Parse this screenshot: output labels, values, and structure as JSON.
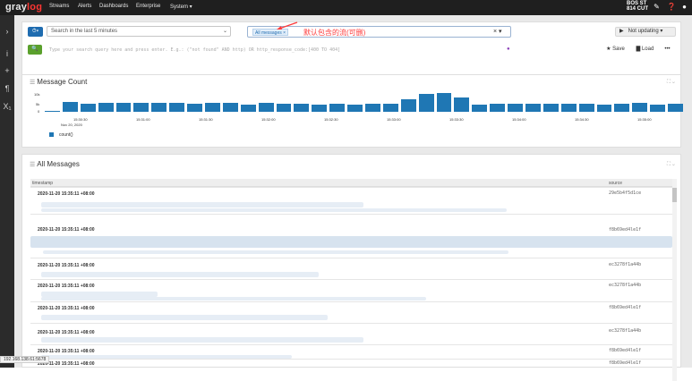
{
  "navbar": {
    "logo_gray": "gray",
    "logo_log": "log",
    "items": [
      "Streams",
      "Alerts",
      "Dashboards",
      "Enterprise",
      "System ▾"
    ],
    "time_top": "BOS ST",
    "time_bottom": "814 CUT",
    "icons": [
      "edit-icon",
      "help-icon",
      "user-icon"
    ]
  },
  "sidebar": {
    "icons": [
      "chevron-right-icon",
      "info-icon",
      "plus-icon",
      "paragraph-icon",
      "x-subscript-icon"
    ]
  },
  "search": {
    "time_range": "Search in the last 5 minutes",
    "stream_tag": "All messages",
    "annotation": "默认包含的流(可删)",
    "query_placeholder": "Type your search query here and press enter. E.g.: (\"not found\" AND http) OR http_response_code:[400 TO 404]",
    "not_updating": "Not updating",
    "save": "Save",
    "load": "Load",
    "more": "•••"
  },
  "message_count": {
    "title": "Message Count",
    "legend": "count()"
  },
  "chart_data": {
    "type": "bar",
    "title": "Message Count",
    "ylim": [
      0,
      10000
    ],
    "yticks": [
      "10k",
      "5k",
      "0"
    ],
    "xticks": [
      "15:30:30",
      "15:31:00",
      "15:31:30",
      "15:32:00",
      "15:32:30",
      "15:33:00",
      "15:33:30",
      "15:34:00",
      "15:34:30",
      "15:35:00"
    ],
    "xdate": "Nov 20, 2020",
    "values": [
      500,
      5300,
      4400,
      4600,
      4700,
      4700,
      5000,
      4800,
      4500,
      4600,
      4900,
      4000,
      4800,
      4300,
      4300,
      4000,
      4500,
      3600,
      4100,
      4300,
      6700,
      9300,
      10000,
      7800,
      3700,
      4500,
      4100,
      4500,
      4200,
      4200,
      4500,
      4000,
      4200,
      4600,
      3700,
      4400
    ],
    "series": [
      {
        "name": "count()",
        "values": []
      }
    ],
    "grid": false,
    "legend": "bottom-left"
  },
  "all_messages": {
    "title": "All Messages",
    "columns": [
      "timestamp",
      "source"
    ],
    "rows": [
      {
        "ts": "2020-11-20 15:35:11 +08:00",
        "source": "29e5b4f5d1ce"
      },
      {
        "ts": "2020-11-20 15:35:11 +08:00",
        "source": "f8b69ed4le1f"
      },
      {
        "ts": "2020-11-20 15:35:11 +08:00",
        "source": "ec3278f1a44b"
      },
      {
        "ts": "2020-11-20 15:35:11 +08:00",
        "source": "ec3278f1a44b"
      },
      {
        "ts": "2020-11-20 15:35:11 +08:00",
        "source": "f8b69ed4le1f"
      },
      {
        "ts": "2020-11-20 15:35:11 +08:00",
        "source": "ec3278f1a44b"
      },
      {
        "ts": "2020-11-20 15:35:11 +08:00",
        "source": "f8b69ed4le1f"
      },
      {
        "ts": "2020-11-20 15:35:11 +08:00",
        "source": "f8b69ed4le1f"
      }
    ]
  },
  "status_url": "192.168.138.61:5678"
}
